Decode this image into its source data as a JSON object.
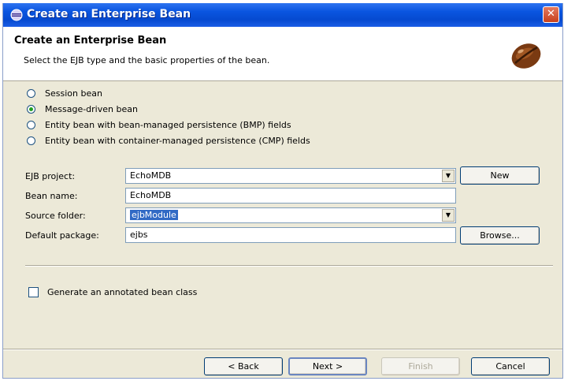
{
  "window": {
    "title": "Create an Enterprise Bean",
    "close_glyph": "✕"
  },
  "header": {
    "title": "Create an Enterprise Bean",
    "description": "Select the EJB type and the basic properties of the bean."
  },
  "bean_types": [
    {
      "label": "Session bean",
      "selected": false
    },
    {
      "label": "Message-driven bean",
      "selected": true
    },
    {
      "label": "Entity bean with bean-managed persistence (BMP) fields",
      "selected": false
    },
    {
      "label": "Entity bean with container-managed persistence (CMP) fields",
      "selected": false
    }
  ],
  "form": {
    "ejb_project_label": "EJB project:",
    "ejb_project_value": "EchoMDB",
    "new_button": "New",
    "bean_name_label": "Bean name:",
    "bean_name_value": "EchoMDB",
    "source_folder_label": "Source folder:",
    "source_folder_value": "ejbModule",
    "default_package_label": "Default package:",
    "default_package_value": "ejbs",
    "browse_button": "Browse..."
  },
  "options": {
    "annotated_label": "Generate an annotated bean class",
    "annotated_checked": false
  },
  "footer": {
    "back": "< Back",
    "next": "Next >",
    "finish": "Finish",
    "cancel": "Cancel"
  },
  "colors": {
    "title_bar": "#0a55e0",
    "dialog_bg": "#ece9d8",
    "selection": "#316ac5"
  },
  "icons": [
    "eclipse-icon",
    "close-icon",
    "bean-icon",
    "dropdown-arrow-icon"
  ]
}
